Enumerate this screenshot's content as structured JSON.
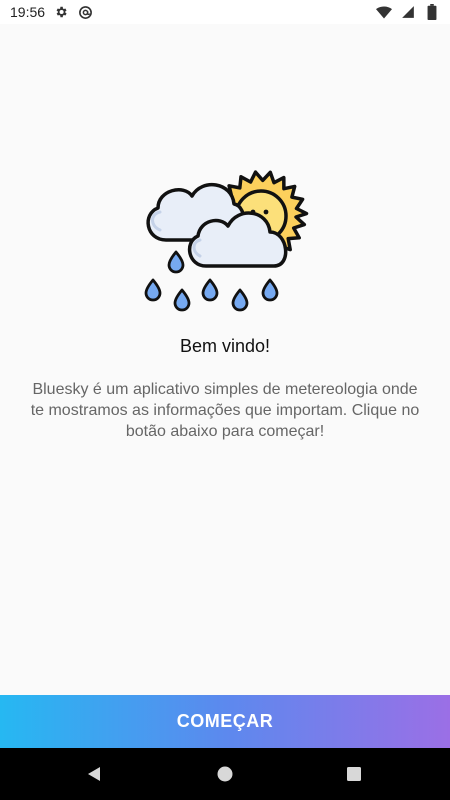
{
  "status_bar": {
    "time": "19:56",
    "left_icons": [
      "gear-icon",
      "at-sign-icon"
    ],
    "right_icons": [
      "wifi-icon",
      "signal-icon",
      "battery-icon"
    ]
  },
  "welcome": {
    "illustration": "sun-cloud-rain-icon",
    "title": "Bem vindo!",
    "description": "Bluesky é um aplicativo simples de metereologia onde te mostramos as informações que importam. Clique no botão abaixo para começar!"
  },
  "cta": {
    "label": "COMEÇAR",
    "gradient_start": "#26b8f2",
    "gradient_end": "#9b6fe6"
  },
  "nav_bar": {
    "buttons": [
      "back-icon",
      "home-icon",
      "recents-icon"
    ]
  },
  "colors": {
    "background": "#fafafa",
    "title": "#111111",
    "description": "#666666"
  }
}
